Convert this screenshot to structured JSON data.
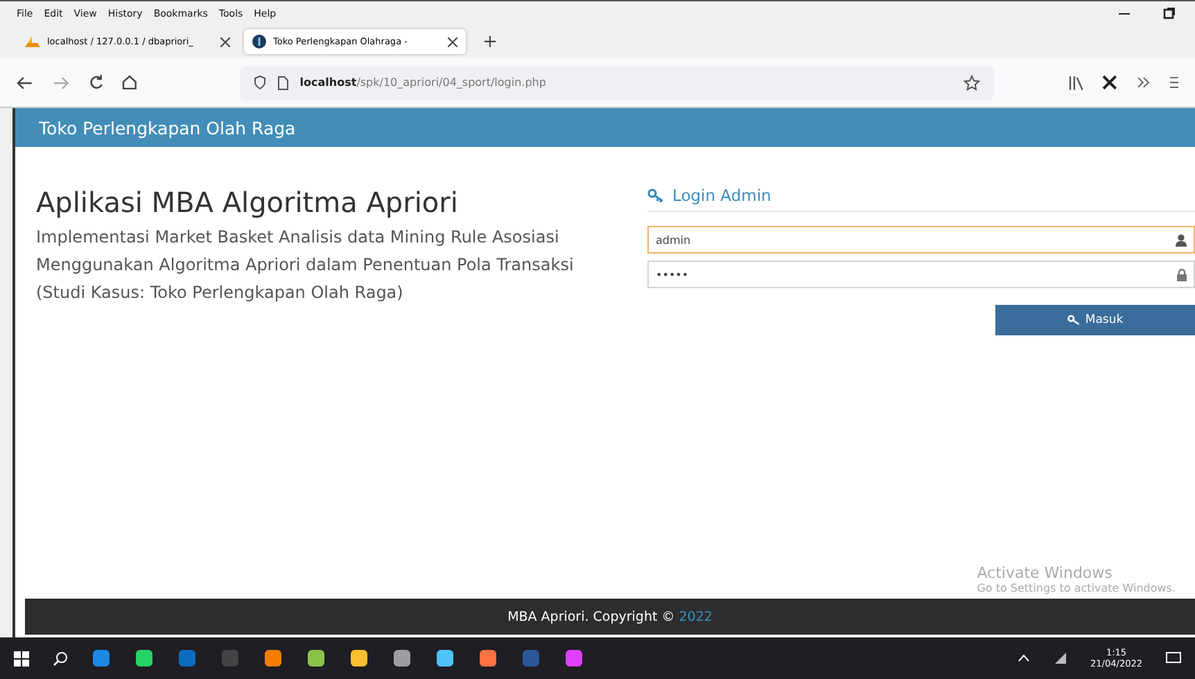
{
  "browser": {
    "menu": [
      "File",
      "Edit",
      "View",
      "History",
      "Bookmarks",
      "Tools",
      "Help"
    ],
    "tabs": [
      {
        "title": "localhost / 127.0.0.1 / dbapriori_",
        "selected": false,
        "kind": "db"
      },
      {
        "title": "Toko Perlengkapan Olahraga - ",
        "selected": true,
        "kind": "site"
      }
    ],
    "new_tab": "+",
    "url_host": "localhost",
    "url_path": "/spk/10_apriori/04_sport/login.php"
  },
  "navbar": {
    "brand": "Toko Perlengkapan Olah Raga"
  },
  "intro": {
    "title": "Aplikasi MBA Algoritma Apriori",
    "description": "Implementasi Market Basket Analisis data Mining Rule Asosiasi Menggunakan Algoritma Apriori dalam Penentuan Pola Transaksi (Studi Kasus: Toko Perlengkapan Olah Raga)"
  },
  "login": {
    "heading": "Login Admin",
    "username": "admin",
    "password": "•••••",
    "button": "Masuk"
  },
  "footer": {
    "text": "MBA Apriori. Copyright ©",
    "year": "2022"
  },
  "os_notice": {
    "title": "Activate Windows",
    "subtitle": "Go to Settings to activate Windows."
  },
  "taskbar": {
    "time": "1:15",
    "date": "21/04/2022"
  }
}
